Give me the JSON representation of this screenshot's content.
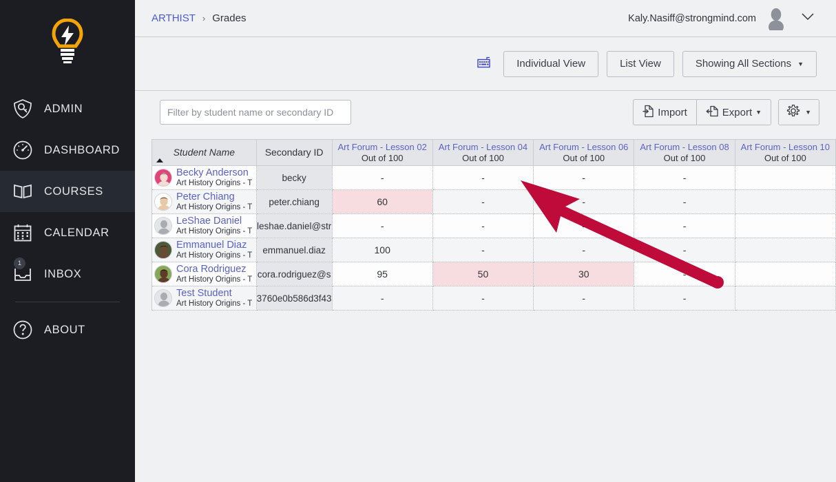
{
  "sidebar": {
    "logo_name": "lightbulb-logo",
    "items": [
      {
        "label": "ADMIN",
        "icon": "shield-key-icon",
        "active": false,
        "badge": ""
      },
      {
        "label": "DASHBOARD",
        "icon": "gauge-icon",
        "active": false,
        "badge": ""
      },
      {
        "label": "COURSES",
        "icon": "book-icon",
        "active": true,
        "badge": ""
      },
      {
        "label": "CALENDAR",
        "icon": "calendar-icon",
        "active": false,
        "badge": ""
      },
      {
        "label": "INBOX",
        "icon": "inbox-icon",
        "active": false,
        "badge": "1"
      }
    ],
    "about": {
      "label": "ABOUT",
      "icon": "question-circle-icon"
    },
    "collapse_icon": "chevron-left-icon"
  },
  "topbar": {
    "breadcrumb_root": "ARTHIST",
    "breadcrumb_sep": "›",
    "breadcrumb_current": "Grades",
    "user_email": "Kaly.Nasiff@strongmind.com",
    "avatar_name": "user-avatar",
    "chevron_icon": "chevron-down-icon"
  },
  "viewbar": {
    "keyboard_icon": "keyboard-icon",
    "individual_view": "Individual View",
    "list_view": "List View",
    "sections_filter": "Showing All Sections",
    "caret": "▼"
  },
  "filterbar": {
    "filter_placeholder": "Filter by student name or secondary ID",
    "filter_value": "",
    "import_label": "Import",
    "export_label": "Export",
    "import_icon": "import-document-icon",
    "export_icon": "export-document-icon",
    "gear_icon": "gear-icon",
    "caret": "▼"
  },
  "grid": {
    "columns": [
      {
        "key": "name",
        "label": "Student Name",
        "sub": "",
        "sorted": "asc"
      },
      {
        "key": "sid",
        "label": "Secondary ID",
        "sub": ""
      },
      {
        "key": "a02",
        "label": "Art Forum - Lesson 02",
        "sub": "Out of 100"
      },
      {
        "key": "a04",
        "label": "Art Forum - Lesson 04",
        "sub": "Out of 100"
      },
      {
        "key": "a06",
        "label": "Art Forum - Lesson 06",
        "sub": "Out of 100"
      },
      {
        "key": "a08",
        "label": "Art Forum - Lesson 08",
        "sub": "Out of 100"
      },
      {
        "key": "a10",
        "label": "Art Forum - Lesson 10",
        "sub": "Out of 100"
      }
    ],
    "rows": [
      {
        "name": "Becky Anderson",
        "course": "Art History Origins - T",
        "sid": "becky",
        "avatar": "photo-female-1",
        "grades": [
          {
            "value": "-",
            "flagged": false
          },
          {
            "value": "-",
            "flagged": false
          },
          {
            "value": "-",
            "flagged": false
          },
          {
            "value": "-",
            "flagged": false
          },
          {
            "value": "",
            "flagged": false
          }
        ]
      },
      {
        "name": "Peter Chiang",
        "course": "Art History Origins - T",
        "sid": "peter.chiang",
        "avatar": "photo-male-1",
        "grades": [
          {
            "value": "60",
            "flagged": true
          },
          {
            "value": "-",
            "flagged": false
          },
          {
            "value": "-",
            "flagged": false
          },
          {
            "value": "-",
            "flagged": false
          },
          {
            "value": "",
            "flagged": false
          }
        ]
      },
      {
        "name": "LeShae Daniel",
        "course": "Art History Origins - T",
        "sid": "leshae.daniel@str",
        "avatar": "placeholder-avatar",
        "grades": [
          {
            "value": "-",
            "flagged": false
          },
          {
            "value": "-",
            "flagged": false
          },
          {
            "value": "-",
            "flagged": false
          },
          {
            "value": "-",
            "flagged": false
          },
          {
            "value": "",
            "flagged": false
          }
        ]
      },
      {
        "name": "Emmanuel Diaz",
        "course": "Art History Origins - T",
        "sid": "emmanuel.diaz",
        "avatar": "photo-male-2",
        "grades": [
          {
            "value": "100",
            "flagged": false
          },
          {
            "value": "-",
            "flagged": false
          },
          {
            "value": "-",
            "flagged": false
          },
          {
            "value": "-",
            "flagged": false
          },
          {
            "value": "",
            "flagged": false
          }
        ]
      },
      {
        "name": "Cora Rodriguez",
        "course": "Art History Origins - T",
        "sid": "cora.rodriguez@s",
        "avatar": "photo-female-2",
        "grades": [
          {
            "value": "95",
            "flagged": false
          },
          {
            "value": "50",
            "flagged": true
          },
          {
            "value": "30",
            "flagged": true
          },
          {
            "value": "-",
            "flagged": false
          },
          {
            "value": "",
            "flagged": false
          }
        ]
      },
      {
        "name": "Test Student",
        "course": "Art History Origins - T",
        "sid": "3760e0b586d3f43",
        "avatar": "placeholder-avatar",
        "grades": [
          {
            "value": "-",
            "flagged": false
          },
          {
            "value": "-",
            "flagged": false
          },
          {
            "value": "-",
            "flagged": false
          },
          {
            "value": "-",
            "flagged": false
          },
          {
            "value": "",
            "flagged": false
          }
        ]
      }
    ]
  },
  "annotation": {
    "type": "arrow",
    "color": "#be0b39",
    "points_to": "Art Forum - Lesson 02 cell for Becky Anderson"
  },
  "colors": {
    "sidebar_bg": "#1b1d23",
    "accent_link": "#5a62c4",
    "page_bg": "#f0f1f3",
    "flag_pink": "#f8dde0",
    "logo_yellow": "#f5a406"
  }
}
